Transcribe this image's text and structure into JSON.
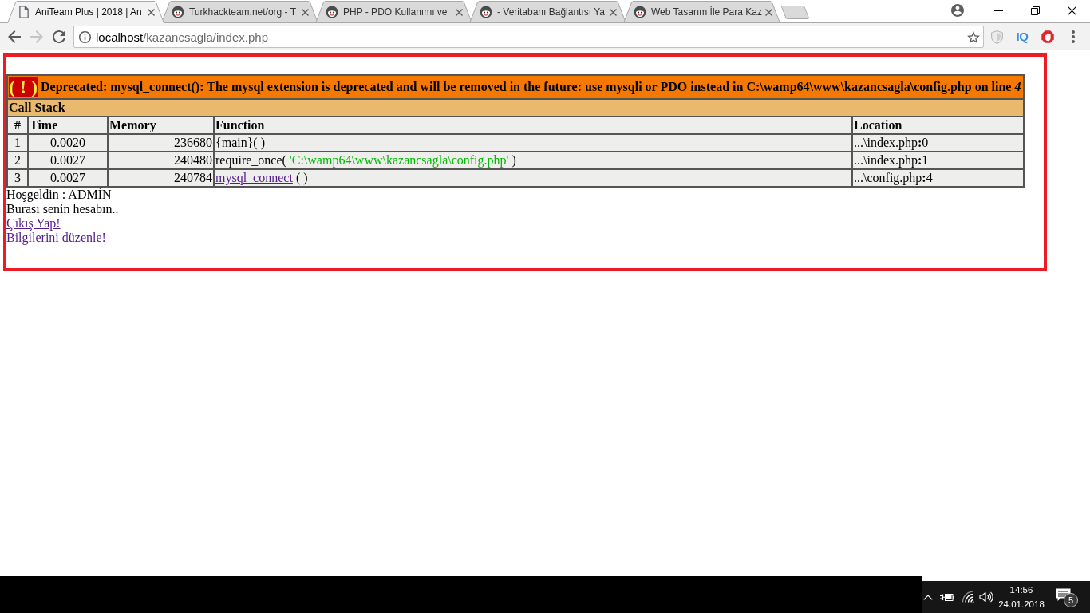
{
  "browser": {
    "tabs": [
      {
        "kind": "page",
        "title": "AniTeam Plus | 2018 | An",
        "selected": true
      },
      {
        "kind": "site",
        "title": "Turkhackteam.net/org - T",
        "selected": false
      },
      {
        "kind": "site",
        "title": "PHP - PDO Kullanımı ve",
        "selected": false
      },
      {
        "kind": "site",
        "title": "- Veritabanı Bağlantısı Ya",
        "selected": false
      },
      {
        "kind": "site",
        "title": "Web Tasarım İle Para Kaz",
        "selected": false
      }
    ],
    "navigation": [
      {
        "kind": "back",
        "disabled": false
      },
      {
        "kind": "forward",
        "disabled": true
      },
      {
        "kind": "reload",
        "disabled": false
      }
    ],
    "address": {
      "host": "localhost",
      "path": "/kazancsagla/index.php"
    },
    "extensions": [
      {
        "kind": "shield"
      },
      {
        "kind": "iq",
        "label": "IQ"
      },
      {
        "kind": "stop"
      }
    ]
  },
  "page": {
    "error": {
      "sign": "( ! )",
      "message": "Deprecated: mysql_connect(): The mysql extension is deprecated and will be removed in the future: use mysqli or PDO instead in C:\\wamp64\\www\\kazancsagla\\config.php on line *4*",
      "section": "Call Stack",
      "columns": [
        "#",
        "Time",
        "Memory",
        "Function",
        "Location"
      ],
      "rows": [
        {
          "index": "1",
          "time": "0.0020",
          "memory": "236680",
          "function": {
            "kind": "plain",
            "text": "{main}( )"
          },
          "location": "...\\index.php**:**0"
        },
        {
          "index": "2",
          "time": "0.0027",
          "memory": "240480",
          "function": {
            "kind": "call",
            "text": "require_once(",
            "argument": "'C:\\wamp64\\www\\kazancsagla\\config.php'",
            "close": ")"
          },
          "location": "...\\index.php**:**1"
        },
        {
          "index": "3",
          "time": "0.0027",
          "memory": "240784",
          "function": {
            "kind": "link",
            "text": "mysql_connect",
            "suffix": "( )"
          },
          "location": "...\\config.php**:**4"
        }
      ]
    },
    "lines": [
      "Hoşgeldin : ADMİN",
      "Burası senin hesabın.."
    ],
    "links": [
      "Çıkış Yap!",
      "Bilgilerini düzenle!"
    ]
  },
  "taskbar": {
    "time": "14:56",
    "date": "24.01.2018",
    "notifications": "5"
  }
}
